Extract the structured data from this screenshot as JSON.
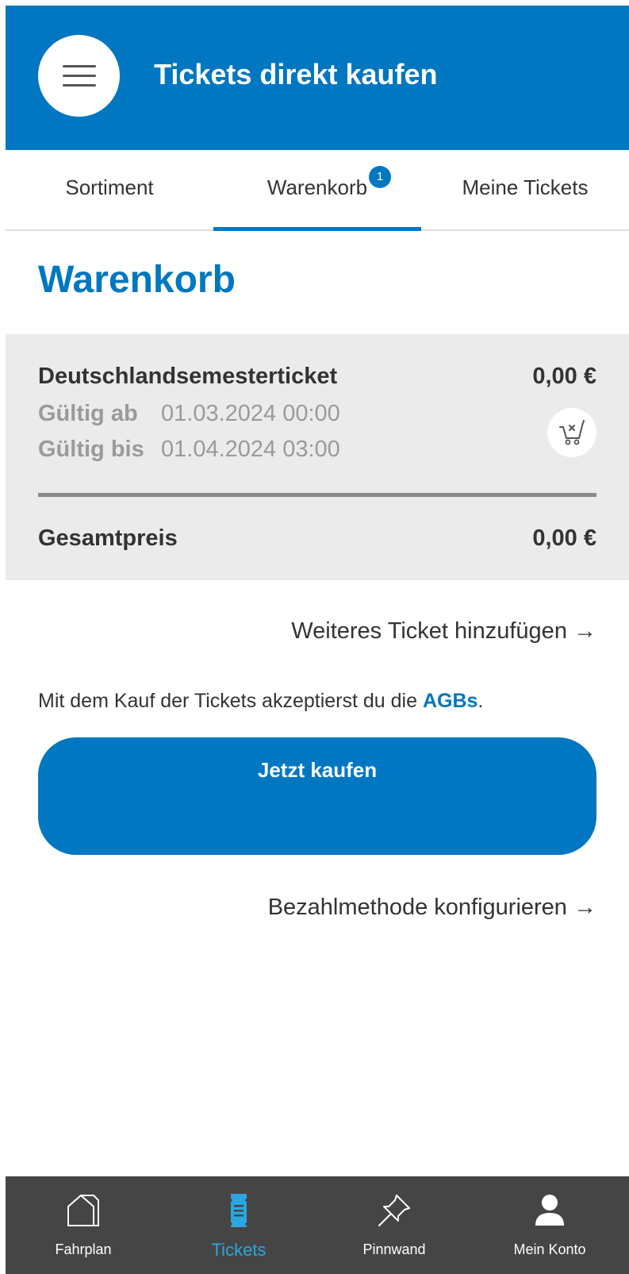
{
  "header": {
    "title": "Tickets direkt kaufen",
    "menu_icon": "hamburger-menu-icon"
  },
  "tabs": [
    {
      "label": "Sortiment",
      "active": false
    },
    {
      "label": "Warenkorb",
      "active": true,
      "badge": "1"
    },
    {
      "label": "Meine Tickets",
      "active": false
    }
  ],
  "page_title": "Warenkorb",
  "cart": {
    "item": {
      "name": "Deutschlandsemesterticket",
      "price": "0,00 €",
      "valid_from_label": "Gültig ab",
      "valid_from": "01.03.2024 00:00",
      "valid_to_label": "Gültig bis",
      "valid_to": "01.04.2024 03:00",
      "remove_icon": "cart-remove-icon"
    },
    "total_label": "Gesamtpreis",
    "total_value": "0,00 €"
  },
  "add_ticket_link": "Weiteres Ticket hinzufügen →",
  "agb": {
    "prefix": "Mit dem Kauf der Tickets akzeptierst du die ",
    "link": "AGBs",
    "suffix": "."
  },
  "buy_button": "Jetzt kaufen",
  "payment_link": "Bezahlmethode konfigurieren →",
  "bottom_nav": [
    {
      "label": "Fahrplan",
      "icon": "home-icon",
      "active": false
    },
    {
      "label": "Tickets",
      "icon": "ticket-icon",
      "active": true
    },
    {
      "label": "Pinnwand",
      "icon": "pin-icon",
      "active": false
    },
    {
      "label": "Mein Konto",
      "icon": "user-icon",
      "active": false
    }
  ],
  "colors": {
    "primary": "#0077c0",
    "active_nav": "#2aa7e0",
    "nav_background": "#454545",
    "cart_background": "#ebebeb"
  }
}
